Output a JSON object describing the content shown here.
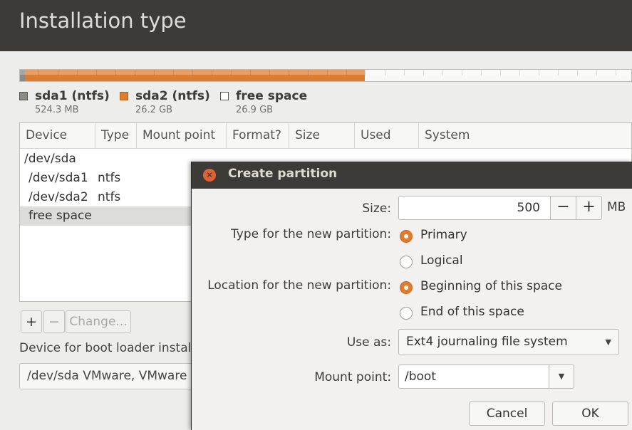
{
  "window": {
    "title": "Installation type"
  },
  "disk": {
    "legend": [
      {
        "name": "sda1 (ntfs)",
        "size": "524.3 MB",
        "color": "#8c8a85"
      },
      {
        "name": "sda2 (ntfs)",
        "size": "26.2 GB",
        "color": "#e07c2e"
      },
      {
        "name": "free space",
        "size": "26.9 GB",
        "color": "#ffffff"
      }
    ]
  },
  "table": {
    "headers": [
      "Device",
      "Type",
      "Mount point",
      "Format?",
      "Size",
      "Used",
      "System"
    ],
    "rows": [
      {
        "device": "/dev/sda",
        "type": ""
      },
      {
        "device": "/dev/sda1",
        "type": "ntfs"
      },
      {
        "device": "/dev/sda2",
        "type": "ntfs"
      },
      {
        "device": "free space",
        "type": ""
      }
    ]
  },
  "toolbar": {
    "add": "+",
    "remove": "−",
    "change": "Change..."
  },
  "bootloader": {
    "label": "Device for boot loader installation:",
    "value": "/dev/sda   VMware, VMware Virtual S"
  },
  "dialog": {
    "title": "Create partition",
    "size_label": "Size:",
    "size_value": "500",
    "minus": "−",
    "plus": "+",
    "size_unit": "MB",
    "type_label": "Type for the new partition:",
    "type_primary": "Primary",
    "type_logical": "Logical",
    "location_label": "Location for the new partition:",
    "loc_beginning": "Beginning of this space",
    "loc_end": "End of this space",
    "useas_label": "Use as:",
    "useas_value": "Ext4 journaling file system",
    "mount_label": "Mount point:",
    "mount_value": "/boot",
    "cancel": "Cancel",
    "ok": "OK"
  },
  "colors": {
    "accent": "#e07c2e",
    "titlebar": "#3c3b37"
  }
}
